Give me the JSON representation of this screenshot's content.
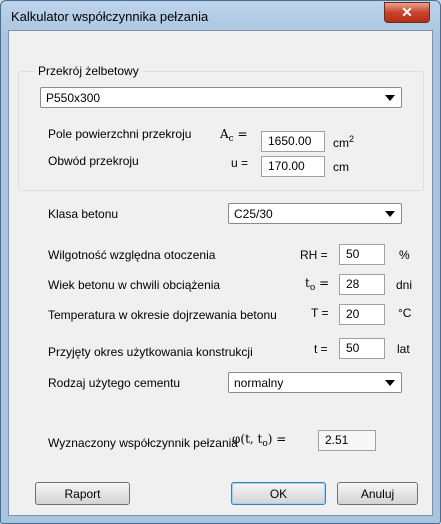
{
  "window": {
    "title": "Kalkulator współczynnika pełzania",
    "close": "✕"
  },
  "section": {
    "label": "Przekrój żelbetowy",
    "select_value": "P550x300",
    "area_label": "Pole powierzchni przekroju",
    "area_symbol": "A",
    "area_symbol_sub": "c",
    "area_eq": "=",
    "area_value": "1650.00",
    "area_unit": "cm",
    "area_unit_sup": "2",
    "perimeter_label": "Obwód przekroju",
    "perimeter_symbol": "u =",
    "perimeter_value": "170.00",
    "perimeter_unit": "cm"
  },
  "params": {
    "concrete_class_label": "Klasa betonu",
    "concrete_class_value": "C25/30",
    "humidity_label": "Wilgotność względna otoczenia",
    "humidity_symbol": "RH =",
    "humidity_value": "50",
    "humidity_unit": "%",
    "age_label": "Wiek betonu w chwili obciążenia",
    "age_symbol": "t",
    "age_symbol_sub": "o",
    "age_eq": "=",
    "age_value": "28",
    "age_unit": "dni",
    "temp_label": "Temperatura w okresie dojrzewania betonu",
    "temp_symbol": "T =",
    "temp_value": "20",
    "temp_unit": "°C",
    "service_label": "Przyjęty okres użytkowania konstrukcji",
    "service_symbol": "t =",
    "service_value": "50",
    "service_unit": "lat",
    "cement_label": "Rodzaj użytego cementu",
    "cement_value": "normalny"
  },
  "result": {
    "label": "Wyznaczony współczynnik pełzania",
    "symbol": "φ(t, t",
    "symbol_sub": "o",
    "symbol_end": ") =",
    "value": "2.51"
  },
  "buttons": {
    "report": "Raport",
    "ok": "OK",
    "cancel": "Anuluj"
  }
}
